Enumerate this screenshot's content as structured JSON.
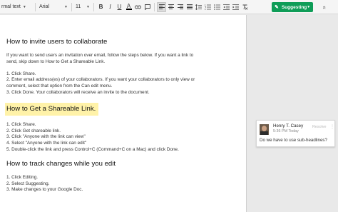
{
  "toolbar": {
    "style_select": "rmal text",
    "font_select": "Arial",
    "size_select": "11",
    "bold": "B",
    "italic": "I",
    "underline": "U",
    "text_color": "A",
    "mode_button": "Suggesting",
    "collapse": "«"
  },
  "doc": {
    "sections": [
      {
        "heading": "How to invite users to collaborate",
        "highlighted": false,
        "lines": [
          "If you want to send users an invitation over email, follow the steps below. If you want a link to",
          "send, skip down to How to Get a Shareable Link.",
          "",
          "1. Click Share.",
          "2. Enter email address(es) of your collaborators. If you want your collaborators to only view or",
          "comment, select that option from the Can edit menu.",
          "3. Click Done. Your collaborators will receive an invite to the document."
        ]
      },
      {
        "heading": "How to Get a Shareable Link.",
        "highlighted": true,
        "lines": [
          "1. Click Share.",
          "2. Click Get shareable link.",
          "3. Click \"Anyone with the link can view\"",
          "4. Select \"Anyone with the link can edit\"",
          "5. Double-click the link and press Control+C (Command+C on a Mac) and click Done."
        ]
      },
      {
        "heading": "How to track changes while you edit",
        "highlighted": false,
        "lines": [
          "1. Click Editing.",
          "2. Select Suggesting.",
          "3. Make changes to your Google Doc."
        ]
      }
    ]
  },
  "comment": {
    "author": "Henry T. Casey",
    "time": "5:36 PM Today",
    "resolve": "Resolve",
    "more": "⋮",
    "text": "Do we have to use sub-headlines?"
  },
  "colors": {
    "accent_green": "#0f9d58",
    "highlight": "#fff2a8"
  }
}
